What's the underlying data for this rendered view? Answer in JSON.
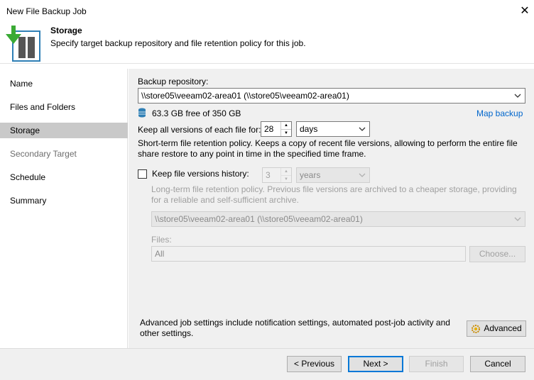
{
  "window": {
    "title": "New File Backup Job",
    "close_label": "✕"
  },
  "header": {
    "title": "Storage",
    "subtitle": "Specify target backup repository and file retention policy for this job."
  },
  "nav": {
    "items": [
      {
        "label": "Name",
        "state": "normal"
      },
      {
        "label": "Files and Folders",
        "state": "normal"
      },
      {
        "label": "Storage",
        "state": "active"
      },
      {
        "label": "Secondary Target",
        "state": "disabled"
      },
      {
        "label": "Schedule",
        "state": "normal"
      },
      {
        "label": "Summary",
        "state": "normal"
      }
    ]
  },
  "storage": {
    "repo_label": "Backup repository:",
    "repo_value": "\\\\store05\\veeam02-area01 (\\\\store05\\veeam02-area01)",
    "free_space": "63.3 GB free of 350 GB",
    "map_backup": "Map backup",
    "keep_all_label": "Keep all versions of each file for:",
    "keep_all_value": "28",
    "keep_all_unit": "days",
    "short_term_desc": "Short-term file retention policy. Keeps a copy of recent file versions, allowing to perform the entire file share restore to any point in time in the specified time frame.",
    "history_label": "Keep file versions history:",
    "history_checked": false,
    "history_value": "3",
    "history_unit": "years",
    "long_term_desc": "Long-term file retention policy. Previous file versions are archived to a cheaper storage, providing for a reliable and self-sufficient archive.",
    "archive_repo_value": "\\\\store05\\veeam02-area01 (\\\\store05\\veeam02-area01)",
    "files_label": "Files:",
    "files_value": "All",
    "choose_label": "Choose...",
    "advanced_desc": "Advanced job settings include notification settings, automated post-job activity and other settings.",
    "advanced_label": "Advanced"
  },
  "footer": {
    "previous": "< Previous",
    "next": "Next >",
    "finish": "Finish",
    "cancel": "Cancel"
  },
  "colors": {
    "accent": "#0078d7",
    "link": "#0066cc",
    "icon_green": "#3aaa35",
    "icon_blue": "#2f7fb5"
  }
}
